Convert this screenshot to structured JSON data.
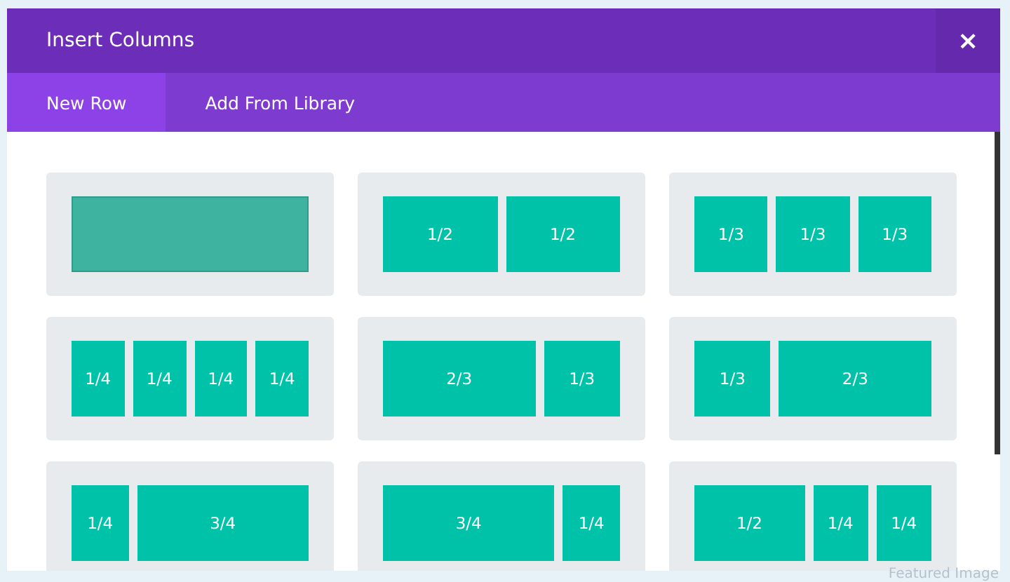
{
  "window": {
    "title": "Insert Columns",
    "close": "×"
  },
  "tabs": [
    {
      "label": "New Row",
      "selected": true
    },
    {
      "label": "Add From Library",
      "selected": false
    }
  ],
  "layouts": [
    {
      "highlighted": true,
      "columns": [
        {}
      ]
    },
    {
      "highlighted": false,
      "columns": [
        {
          "label": "1/2"
        },
        {
          "label": "1/2"
        }
      ]
    },
    {
      "highlighted": false,
      "columns": [
        {
          "label": "1/3"
        },
        {
          "label": "1/3"
        },
        {
          "label": "1/3"
        }
      ]
    },
    {
      "highlighted": false,
      "columns": [
        {
          "label": "1/4"
        },
        {
          "label": "1/4"
        },
        {
          "label": "1/4"
        },
        {
          "label": "1/4"
        }
      ]
    },
    {
      "highlighted": false,
      "columns": [
        {
          "label": "2/3"
        },
        {
          "label": "1/3"
        }
      ]
    },
    {
      "highlighted": false,
      "columns": [
        {
          "label": "1/3"
        },
        {
          "label": "2/3"
        }
      ]
    },
    {
      "highlighted": false,
      "columns": [
        {
          "label": "1/4"
        },
        {
          "label": "3/4"
        }
      ]
    },
    {
      "highlighted": false,
      "columns": [
        {
          "label": "3/4"
        },
        {
          "label": "1/4"
        }
      ]
    },
    {
      "highlighted": false,
      "columns": [
        {
          "label": "1/2"
        },
        {
          "label": "1/4"
        },
        {
          "label": "1/4"
        }
      ]
    }
  ],
  "background_label": "Featured Image"
}
